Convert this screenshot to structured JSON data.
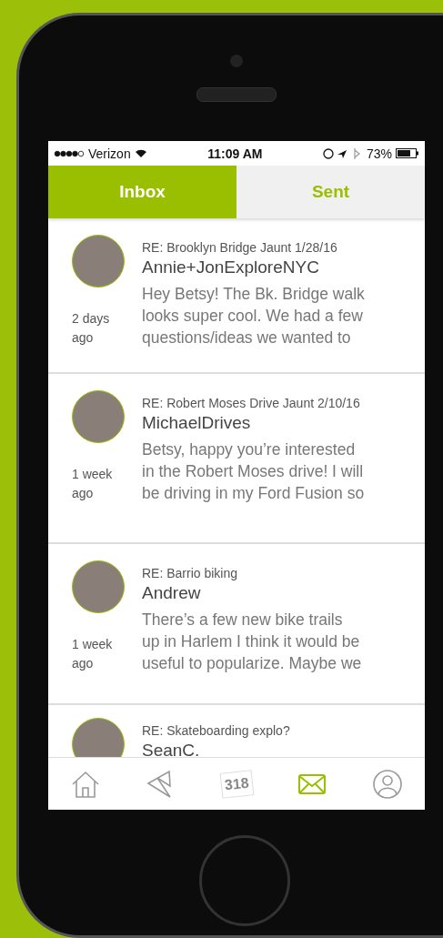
{
  "status_bar": {
    "carrier": "Verizon",
    "time": "11:09 AM",
    "battery": "73%"
  },
  "tabs": [
    {
      "label": "Inbox",
      "selected": true
    },
    {
      "label": "Sent",
      "selected": false
    }
  ],
  "messages": [
    {
      "subject": "RE: Brooklyn Bridge Jaunt 1/28/16",
      "sender": "Annie+JonExploreNYC",
      "time": [
        "2 days",
        "ago"
      ],
      "preview": [
        "Hey Betsy! The Bk. Bridge walk",
        "looks super cool. We had a few",
        "questions/ideas we wanted to"
      ]
    },
    {
      "subject": "RE:  Robert Moses Drive Jaunt 2/10/16",
      "sender": "MichaelDrives",
      "time": [
        "1 week",
        "ago"
      ],
      "preview": [
        "Betsy, happy you’re interested",
        "in the Robert Moses drive! I will",
        "be driving in my Ford Fusion so"
      ]
    },
    {
      "subject": "RE: Barrio biking",
      "sender": "Andrew",
      "time": [
        "1 week",
        "ago"
      ],
      "preview": [
        "There’s a few new bike trails",
        "up in Harlem I think it would be",
        "useful to popularize. Maybe we"
      ]
    },
    {
      "subject": "RE:  Skateboarding explo?",
      "sender": "SeanC."
    }
  ],
  "nav": [
    {
      "kind": "home",
      "selected": false
    },
    {
      "kind": "route",
      "selected": false
    },
    {
      "kind": "counter",
      "label": "318",
      "selected": false
    },
    {
      "kind": "mail",
      "selected": true
    },
    {
      "kind": "profile",
      "selected": false
    }
  ]
}
